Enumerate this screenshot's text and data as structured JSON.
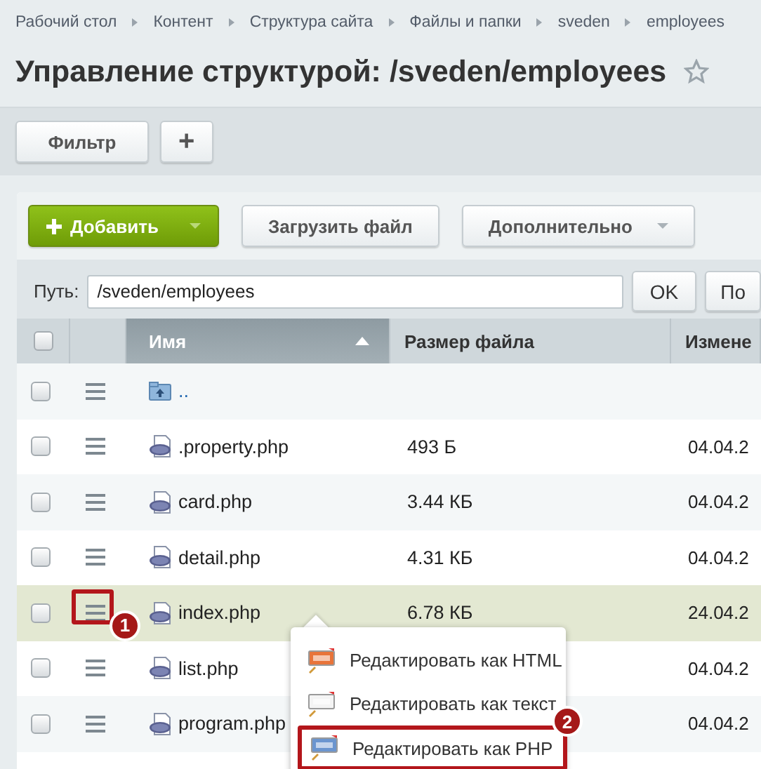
{
  "breadcrumbs": [
    "Рабочий стол",
    "Контент",
    "Структура сайта",
    "Файлы и папки",
    "sveden",
    "employees"
  ],
  "title": "Управление структурой: /sveden/employees",
  "filter_bar": {
    "filter_button": "Фильтр",
    "add_button": "+"
  },
  "toolbar": {
    "add_button": "Добавить",
    "upload_button": "Загрузить файл",
    "more_button": "Дополнительно"
  },
  "path": {
    "label": "Путь:",
    "value": "/sveden/employees",
    "ok_button": "OK",
    "next_button": "По"
  },
  "table": {
    "header_checked": false,
    "columns": [
      {
        "label": "Имя",
        "sorted": true
      },
      {
        "label": "Размер файла"
      },
      {
        "label": "Измене"
      }
    ],
    "rows": [
      {
        "kind": "up",
        "name": "..",
        "checked": false,
        "selected": false
      },
      {
        "kind": "php",
        "name": ".property.php",
        "size": "493 Б",
        "date": "04.04.2",
        "checked": false,
        "selected": false
      },
      {
        "kind": "php",
        "name": "card.php",
        "size": "3.44 КБ",
        "date": "04.04.2",
        "checked": false,
        "selected": false
      },
      {
        "kind": "php",
        "name": "detail.php",
        "size": "4.31 КБ",
        "date": "04.04.2",
        "checked": false,
        "selected": false
      },
      {
        "kind": "php",
        "name": "index.php",
        "size": "6.78 КБ",
        "date": "24.04.2",
        "checked": false,
        "selected": true,
        "callout": "1"
      },
      {
        "kind": "php",
        "name": "list.php",
        "size": "",
        "date": "04.04.2",
        "checked": false,
        "selected": false
      },
      {
        "kind": "php",
        "name": "program.php",
        "size": "",
        "date": "04.04.2",
        "checked": false,
        "selected": false
      }
    ]
  },
  "context_menu": [
    {
      "kind": "html",
      "label": "Редактировать как HTML"
    },
    {
      "kind": "text",
      "label": "Редактировать как текст"
    },
    {
      "kind": "php",
      "label": "Редактировать как PHP",
      "callout": "2"
    }
  ]
}
